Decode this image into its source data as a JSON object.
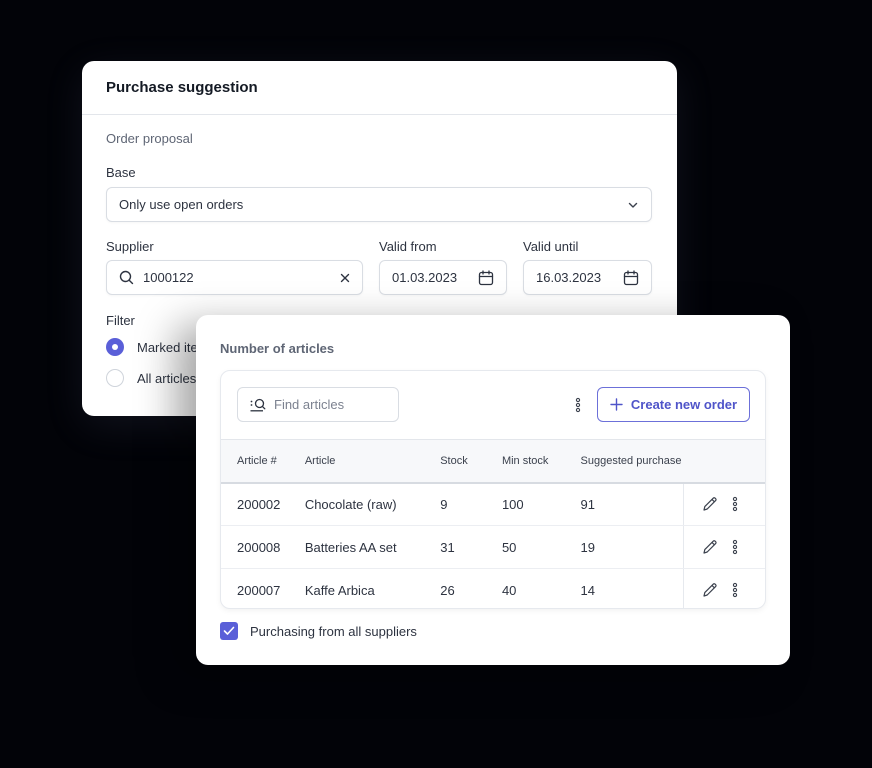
{
  "purchase_panel": {
    "title": "Purchase suggestion",
    "section": "Order proposal",
    "base": {
      "label": "Base",
      "value": "Only use open orders",
      "icon": "chevron-down-icon"
    },
    "supplier": {
      "label": "Supplier",
      "value": "1000122",
      "icon": "search-icon",
      "clear_icon": "close-icon"
    },
    "valid_from": {
      "label": "Valid from",
      "value": "01.03.2023",
      "icon": "calendar-icon"
    },
    "valid_until": {
      "label": "Valid until",
      "value": "16.03.2023",
      "icon": "calendar-icon"
    },
    "filter": {
      "label": "Filter",
      "options": [
        {
          "label": "Marked ite",
          "selected": true
        },
        {
          "label": "All articles",
          "selected": false
        }
      ]
    }
  },
  "articles_panel": {
    "title": "Number of articles",
    "search": {
      "placeholder": "Find articles",
      "icon": "filter-search-icon"
    },
    "more_icon": "kebab-icon",
    "create_button": {
      "label": "Create new order",
      "icon": "plus-icon"
    },
    "table": {
      "columns": [
        "Article #",
        "Article",
        "Stock",
        "Min stock",
        "Suggested purchase"
      ],
      "rows": [
        {
          "article_no": "200002",
          "article": "Chocolate (raw)",
          "stock": "9",
          "min_stock": "100",
          "suggested": "91"
        },
        {
          "article_no": "200008",
          "article": "Batteries AA set",
          "stock": "31",
          "min_stock": "50",
          "suggested": "19"
        },
        {
          "article_no": "200007",
          "article": "Kaffe Arbica",
          "stock": "26",
          "min_stock": "40",
          "suggested": "14"
        }
      ],
      "row_actions": [
        "pencil-icon",
        "kebab-icon"
      ]
    },
    "checkbox": {
      "label": "Purchasing from all suppliers",
      "checked": true
    }
  },
  "colors": {
    "accent": "#5a5fd8",
    "background": "#020308"
  }
}
